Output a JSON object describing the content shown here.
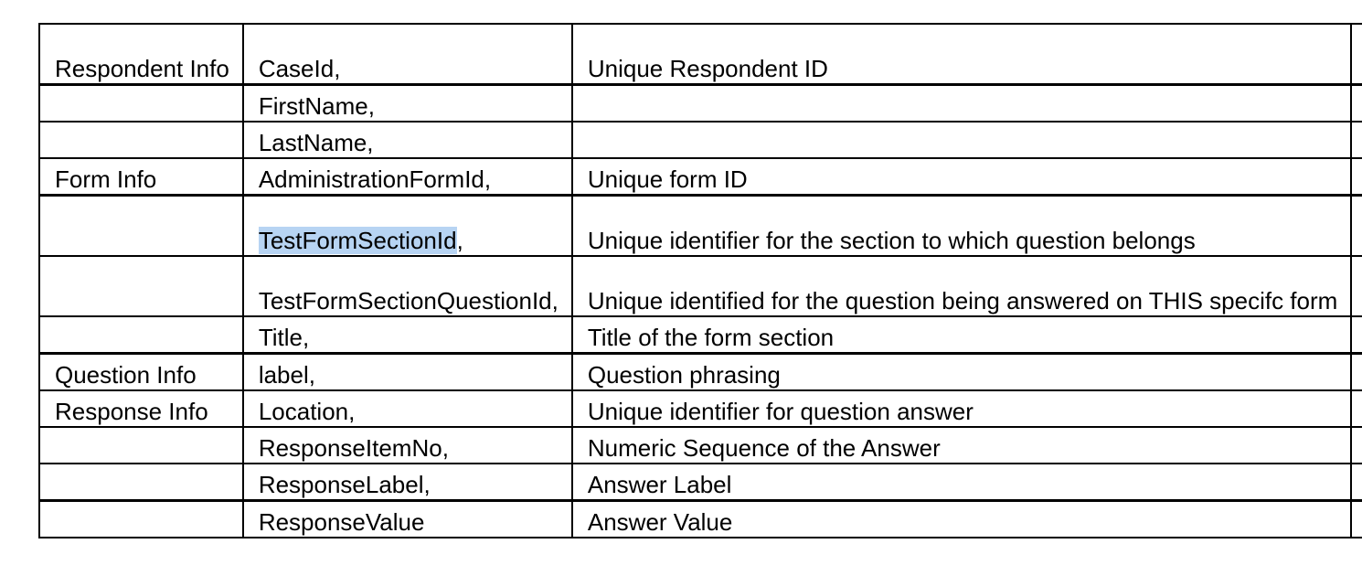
{
  "rows": [
    {
      "group": "Respondent Info",
      "field": "CaseId,",
      "field_highlight": "",
      "field_rest": "",
      "description": "Unique Respondent ID",
      "thick": true,
      "tall": true
    },
    {
      "group": "",
      "field": "FirstName,",
      "field_highlight": "",
      "field_rest": "",
      "description": "",
      "thick": false,
      "tall": false
    },
    {
      "group": "",
      "field": "LastName,",
      "field_highlight": "",
      "field_rest": "",
      "description": "",
      "thick": false,
      "tall": false
    },
    {
      "group": "Form Info",
      "field": "AdministrationFormId,",
      "field_highlight": "",
      "field_rest": "",
      "description": "Unique form ID",
      "thick": true,
      "tall": false
    },
    {
      "group": "",
      "field": "",
      "field_highlight": "TestFormSectionId",
      "field_rest": ",",
      "description": "Unique identifier for the section to which question belongs",
      "thick": false,
      "tall": true
    },
    {
      "group": "",
      "field": "TestFormSectionQuestionId,",
      "field_highlight": "",
      "field_rest": "",
      "description": "Unique identified for the question being answered on THIS specifc form",
      "thick": false,
      "tall": true
    },
    {
      "group": "",
      "field": "Title,",
      "field_highlight": "",
      "field_rest": "",
      "description": "Title of the form section",
      "thick": true,
      "tall": false
    },
    {
      "group": "Question Info",
      "field": "label,",
      "field_highlight": "",
      "field_rest": "",
      "description": "Question phrasing",
      "thick": false,
      "tall": false
    },
    {
      "group": "Response Info",
      "field": "Location,",
      "field_highlight": "",
      "field_rest": "",
      "description": "Unique identifier for question answer",
      "thick": false,
      "tall": false
    },
    {
      "group": "",
      "field": "ResponseItemNo,",
      "field_highlight": "",
      "field_rest": "",
      "description": "Numeric Sequence of the Answer",
      "thick": false,
      "tall": false
    },
    {
      "group": "",
      "field": "ResponseLabel,",
      "field_highlight": "",
      "field_rest": "",
      "description": "Answer Label",
      "thick": true,
      "tall": false
    },
    {
      "group": "",
      "field": "ResponseValue",
      "field_highlight": "",
      "field_rest": "",
      "description": "Answer Value",
      "thick": false,
      "tall": false
    }
  ],
  "colors": {
    "selection_highlight": "#b7d4f3",
    "border": "#000000",
    "text": "#000000",
    "background": "#ffffff"
  }
}
